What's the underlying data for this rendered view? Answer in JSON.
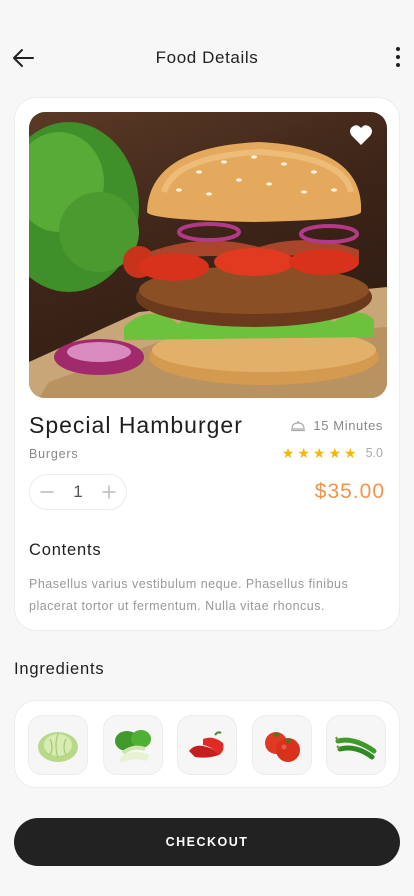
{
  "header": {
    "title": "Food Details",
    "back_icon": "arrow-left-icon",
    "menu_icon": "more-vertical-icon"
  },
  "product": {
    "name": "Special Hamburger",
    "category": "Burgers",
    "time": "15 Minutes",
    "time_icon": "cloche-icon",
    "rating": "5.0",
    "stars": 5,
    "quantity": "1",
    "price": "$35.00",
    "favorite": true
  },
  "contents": {
    "title": "Contents",
    "text": "Phasellus varius vestibulum neque. Phasellus finibus placerat tortor ut fermentum. Nulla vitae rhoncus."
  },
  "ingredients": {
    "title": "Ingredients",
    "items": [
      "cabbage-icon",
      "bok-choy-icon",
      "red-pepper-icon",
      "tomato-icon",
      "green-chili-icon"
    ]
  },
  "actions": {
    "checkout_label": "CHECKOUT"
  },
  "colors": {
    "price": "#f0944a",
    "star": "#f5b700",
    "button": "#222222"
  }
}
